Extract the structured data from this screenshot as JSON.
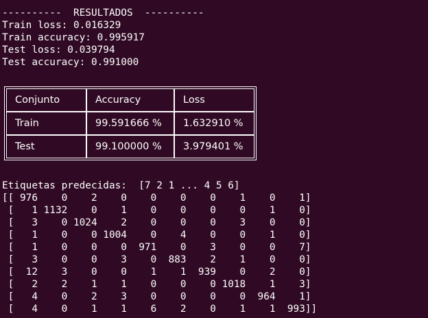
{
  "terminal": {
    "header": "----------  RESULTADOS  ----------",
    "lines": [
      "Train loss: 0.016329",
      "Train accuracy: 0.995917",
      "Test loss: 0.039794",
      "Test accuracy: 0.991000"
    ],
    "table": {
      "headers": [
        "Conjunto",
        "Accuracy",
        "Loss"
      ],
      "rows": [
        [
          "Train",
          "99.591666 %",
          "1.632910 %"
        ],
        [
          "Test",
          "99.100000 %",
          "3.979401 %"
        ]
      ]
    },
    "predicted_label": "Etiquetas predecidas:  [7 2 1 ... 4 5 6]",
    "matrix_lines": [
      "[[ 976    0    2    0    0    0    0    1    0    1]",
      " [   1 1132    0    1    0    0    0    0    1    0]",
      " [   3    0 1024    2    0    0    0    3    0    0]",
      " [   1    0    0 1004    0    4    0    0    1    0]",
      " [   1    0    0    0  971    0    3    0    0    7]",
      " [   3    0    0    3    0  883    2    1    0    0]",
      " [  12    3    0    0    1    1  939    0    2    0]",
      " [   2    2    1    1    0    0    0 1018    1    3]",
      " [   4    0    2    3    0    0    0    0  964    1]",
      " [   4    0    1    1    6    2    0    1    1  993]]"
    ]
  },
  "colors": {
    "background": "#300a24",
    "text": "#ffffff"
  }
}
